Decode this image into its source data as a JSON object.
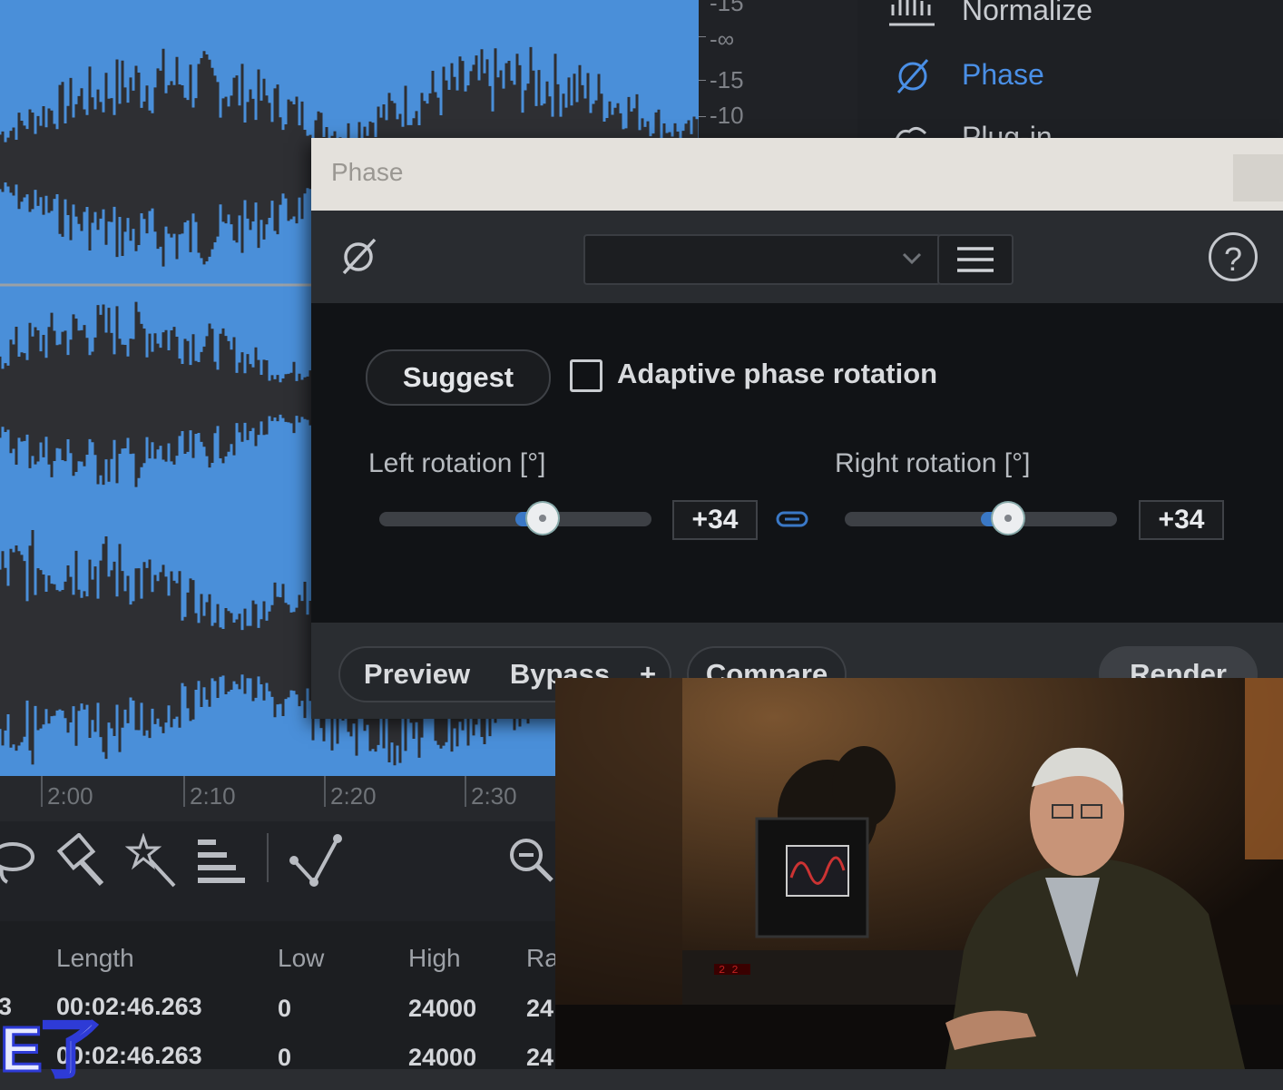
{
  "side_panel": {
    "items": [
      {
        "label": "Normalize",
        "icon": "normalize-icon"
      },
      {
        "label": "Phase",
        "icon": "phase-icon",
        "active": true
      },
      {
        "label": "Plug-in",
        "icon": "plugin-icon"
      }
    ]
  },
  "db_scale": [
    "-15",
    "-∞",
    "-15",
    "-10"
  ],
  "timeline": [
    "2:00",
    "2:10",
    "2:20",
    "2:30"
  ],
  "table": {
    "headers": [
      "Length",
      "Low",
      "High",
      "Ra"
    ],
    "rows": [
      {
        "prefix": "3",
        "length": "00:02:46.263",
        "low": "0",
        "high": "24000",
        "rate": "24"
      },
      {
        "prefix": "",
        "length": "00:02:46.263",
        "low": "0",
        "high": "24000",
        "rate": "24"
      }
    ]
  },
  "subtitle": "E了",
  "dialog": {
    "title": "Phase",
    "header_icon": "phase-icon",
    "preset_value": "",
    "help_label": "?",
    "suggest_label": "Suggest",
    "adaptive_label": "Adaptive phase rotation",
    "adaptive_checked": false,
    "left": {
      "label": "Left rotation [°]",
      "value": "+34",
      "level": 0.6
    },
    "right": {
      "label": "Right rotation [°]",
      "value": "+34",
      "level": 0.6
    },
    "footer": {
      "preview": "Preview",
      "bypass": "Bypass",
      "plus": "+",
      "compare": "Compare",
      "render": "Render"
    }
  },
  "colors": {
    "accent": "#4a8fe6",
    "waveform": "#4a8fd9"
  }
}
